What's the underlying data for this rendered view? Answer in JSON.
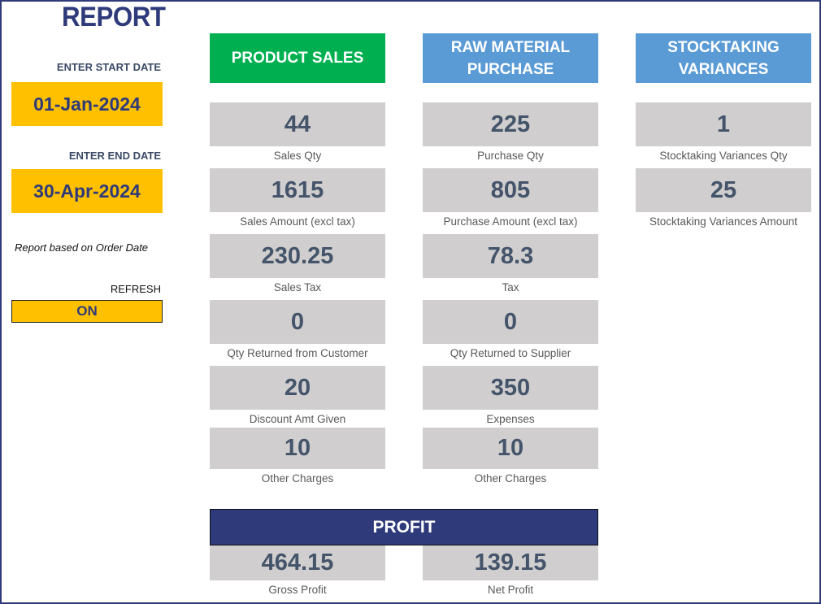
{
  "report": {
    "title": "REPORT",
    "start_date_label": "ENTER START DATE",
    "start_date": "01-Jan-2024",
    "end_date_label": "ENTER END DATE",
    "end_date": "30-Apr-2024",
    "note": "Report based on Order Date",
    "refresh_label": "REFRESH",
    "refresh_value": "ON"
  },
  "colors": {
    "primary_navy": "#2E3A7A",
    "input_yellow": "#FFC000",
    "sales_green": "#00B050",
    "purchase_blue": "#5B9BD5",
    "metric_grey": "#D0CECE",
    "metric_text": "#44546A"
  },
  "sections": {
    "product_sales": {
      "title": "PRODUCT SALES",
      "metrics": [
        {
          "value": "44",
          "label": "Sales Qty"
        },
        {
          "value": "1615",
          "label": "Sales Amount (excl tax)"
        },
        {
          "value": "230.25",
          "label": "Sales Tax"
        },
        {
          "value": "0",
          "label": "Qty Returned from Customer"
        },
        {
          "value": "20",
          "label": "Discount Amt Given"
        },
        {
          "value": "10",
          "label": "Other Charges"
        }
      ]
    },
    "raw_material_purchase": {
      "title_line1": "RAW MATERIAL",
      "title_line2": "PURCHASE",
      "metrics": [
        {
          "value": "225",
          "label": "Purchase Qty"
        },
        {
          "value": "805",
          "label": "Purchase Amount (excl tax)"
        },
        {
          "value": "78.3",
          "label": "Tax"
        },
        {
          "value": "0",
          "label": "Qty Returned to Supplier"
        },
        {
          "value": "350",
          "label": "Expenses"
        },
        {
          "value": "10",
          "label": "Other Charges"
        }
      ]
    },
    "stocktaking_variances": {
      "title_line1": "STOCKTAKING",
      "title_line2": "VARIANCES",
      "metrics": [
        {
          "value": "1",
          "label": "Stocktaking Variances Qty"
        },
        {
          "value": "25",
          "label": "Stocktaking Variances Amount"
        }
      ]
    },
    "profit": {
      "title": "PROFIT",
      "metrics": [
        {
          "value": "464.15",
          "label": "Gross Profit"
        },
        {
          "value": "139.15",
          "label": "Net Profit"
        }
      ]
    }
  }
}
